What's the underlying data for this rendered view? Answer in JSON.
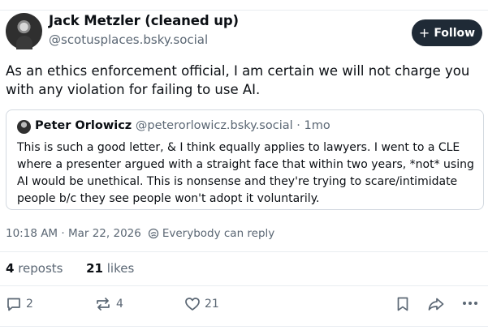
{
  "post": {
    "author_name": "Jack Metzler (cleaned up)",
    "author_handle": "@scotusplaces.bsky.social",
    "follow_label": "Follow",
    "text": "As an ethics enforcement official, I am certain we will not charge you with any violation for failing to use AI.",
    "timestamp": "10:18 AM · Mar 22, 2026",
    "reply_setting": "Everybody can reply"
  },
  "quote": {
    "author_name": "Peter Orlowicz",
    "meta": "@peterorlowicz.bsky.social · 1mo",
    "text": "This is such a good letter, & I think equally applies to lawyers. I went to a CLE where a presenter argued with a straight face that within two years, *not* using AI would be unethical. This is nonsense and they're trying to scare/intimidate people b/c they see people won't adopt it voluntarily."
  },
  "stats": {
    "reposts_count": "4",
    "reposts_label": "reposts",
    "likes_count": "21",
    "likes_label": "likes"
  },
  "actions": {
    "reply_count": "2",
    "repost_count": "4",
    "like_count": "21",
    "icons": [
      "reply-icon",
      "repost-icon",
      "like-icon",
      "bookmark-icon",
      "share-icon",
      "more-icon"
    ]
  },
  "colors": {
    "follow_bg": "#1f2a36",
    "muted_text": "#5b6774"
  }
}
